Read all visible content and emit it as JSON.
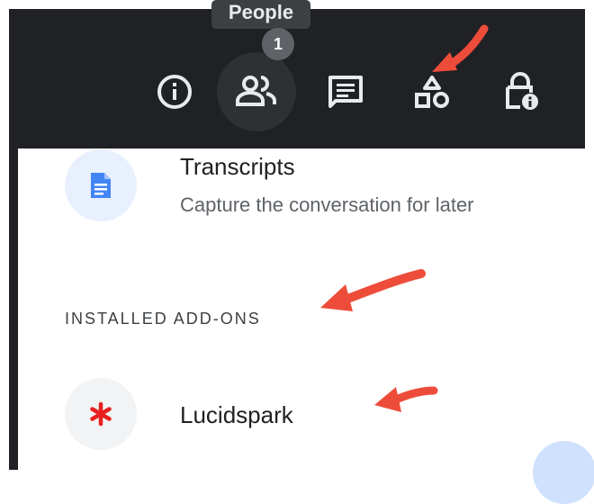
{
  "toolbar": {
    "tooltip_text": "People",
    "people_count": "1",
    "buttons": [
      {
        "icon": "info-icon",
        "label": "Meeting details"
      },
      {
        "icon": "people-icon",
        "label": "People"
      },
      {
        "icon": "chat-icon",
        "label": "Chat"
      },
      {
        "icon": "activities-icon",
        "label": "Activities"
      },
      {
        "icon": "host-controls-icon",
        "label": "Host controls"
      }
    ]
  },
  "panel": {
    "transcripts": {
      "title": "Transcripts",
      "description": "Capture the conversation for later"
    },
    "installed_section_label": "INSTALLED ADD-ONS",
    "addons": [
      {
        "name": "Lucidspark",
        "icon": "lucidspark-asterisk-icon"
      }
    ]
  },
  "colors": {
    "toolbar_bg": "#202124",
    "icon_white": "#e8eaed",
    "arrow_red": "#ee4c3a",
    "docs_blue": "#4285f4",
    "lucid_red": "#e8201f"
  }
}
